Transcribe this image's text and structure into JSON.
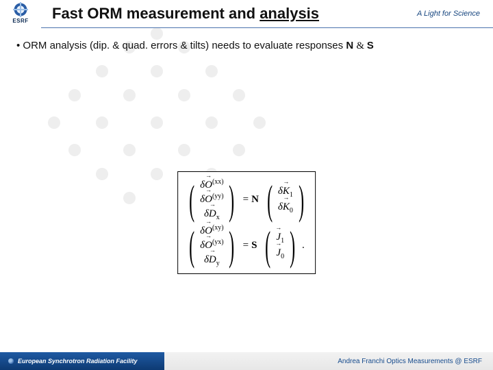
{
  "header": {
    "logo": "ESRF",
    "title_pre": "Fast ORM measurement and ",
    "title_underlined": "analysis",
    "tagline": "A Light for Science"
  },
  "body": {
    "bullet_pre": "• ORM analysis (dip. & quad. errors & tilts) needs to evaluate responses ",
    "bullet_N": "N",
    "bullet_amp": " & ",
    "bullet_S": "S"
  },
  "eq": {
    "N": {
      "lhs": [
        "(xx)",
        "(yy)",
        "x"
      ],
      "matrix": "N",
      "rhs": [
        "1",
        "0"
      ]
    },
    "S": {
      "lhs": [
        "(xy)",
        "(yx)",
        "y"
      ],
      "matrix": "S",
      "rhs": [
        "1",
        "0"
      ]
    }
  },
  "footer": {
    "org": "European Synchrotron Radiation Facility",
    "credit": "Andrea Franchi Optics Measurements  @ ESRF"
  }
}
